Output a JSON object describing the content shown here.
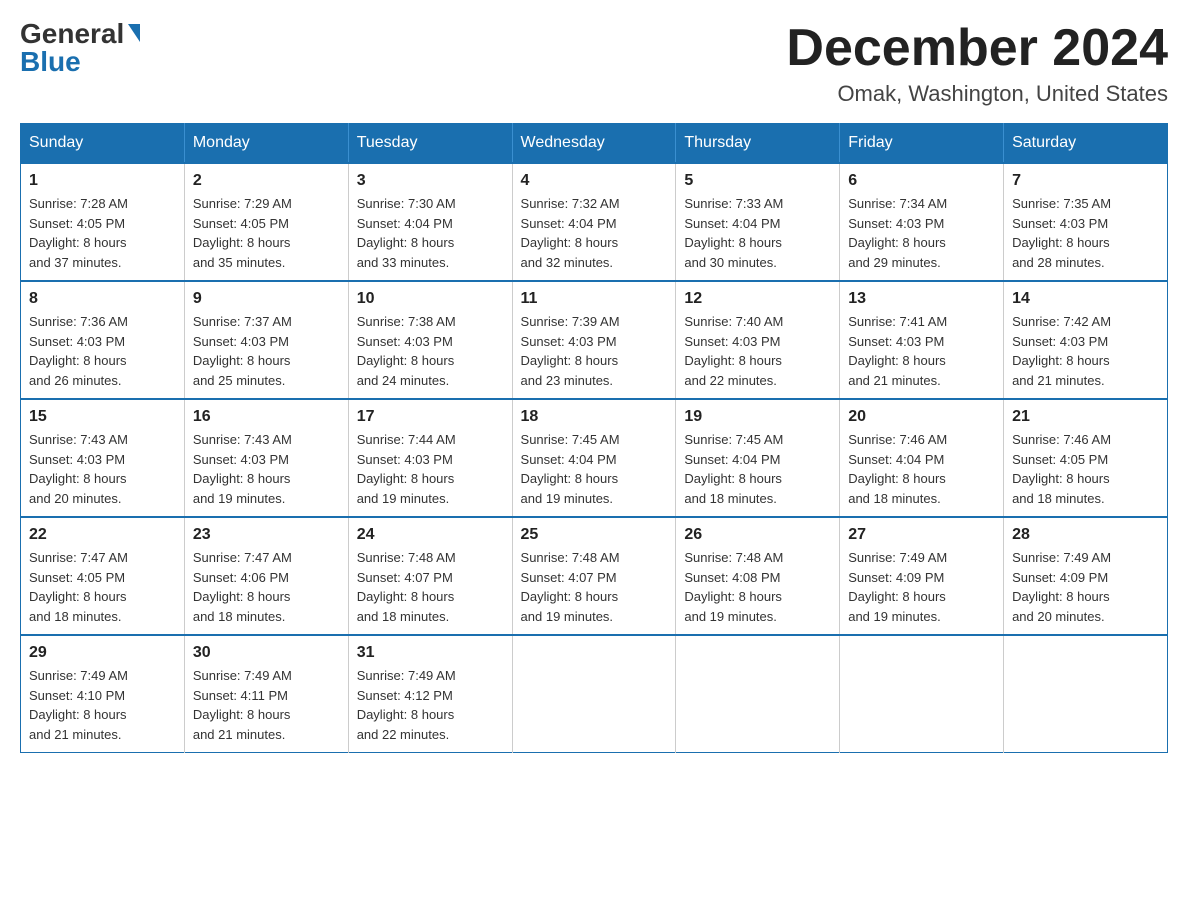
{
  "logo": {
    "general": "General",
    "blue": "Blue"
  },
  "title": "December 2024",
  "subtitle": "Omak, Washington, United States",
  "days_of_week": [
    "Sunday",
    "Monday",
    "Tuesday",
    "Wednesday",
    "Thursday",
    "Friday",
    "Saturday"
  ],
  "weeks": [
    [
      {
        "day": "1",
        "sunrise": "Sunrise: 7:28 AM",
        "sunset": "Sunset: 4:05 PM",
        "daylight": "Daylight: 8 hours",
        "daylight2": "and 37 minutes."
      },
      {
        "day": "2",
        "sunrise": "Sunrise: 7:29 AM",
        "sunset": "Sunset: 4:05 PM",
        "daylight": "Daylight: 8 hours",
        "daylight2": "and 35 minutes."
      },
      {
        "day": "3",
        "sunrise": "Sunrise: 7:30 AM",
        "sunset": "Sunset: 4:04 PM",
        "daylight": "Daylight: 8 hours",
        "daylight2": "and 33 minutes."
      },
      {
        "day": "4",
        "sunrise": "Sunrise: 7:32 AM",
        "sunset": "Sunset: 4:04 PM",
        "daylight": "Daylight: 8 hours",
        "daylight2": "and 32 minutes."
      },
      {
        "day": "5",
        "sunrise": "Sunrise: 7:33 AM",
        "sunset": "Sunset: 4:04 PM",
        "daylight": "Daylight: 8 hours",
        "daylight2": "and 30 minutes."
      },
      {
        "day": "6",
        "sunrise": "Sunrise: 7:34 AM",
        "sunset": "Sunset: 4:03 PM",
        "daylight": "Daylight: 8 hours",
        "daylight2": "and 29 minutes."
      },
      {
        "day": "7",
        "sunrise": "Sunrise: 7:35 AM",
        "sunset": "Sunset: 4:03 PM",
        "daylight": "Daylight: 8 hours",
        "daylight2": "and 28 minutes."
      }
    ],
    [
      {
        "day": "8",
        "sunrise": "Sunrise: 7:36 AM",
        "sunset": "Sunset: 4:03 PM",
        "daylight": "Daylight: 8 hours",
        "daylight2": "and 26 minutes."
      },
      {
        "day": "9",
        "sunrise": "Sunrise: 7:37 AM",
        "sunset": "Sunset: 4:03 PM",
        "daylight": "Daylight: 8 hours",
        "daylight2": "and 25 minutes."
      },
      {
        "day": "10",
        "sunrise": "Sunrise: 7:38 AM",
        "sunset": "Sunset: 4:03 PM",
        "daylight": "Daylight: 8 hours",
        "daylight2": "and 24 minutes."
      },
      {
        "day": "11",
        "sunrise": "Sunrise: 7:39 AM",
        "sunset": "Sunset: 4:03 PM",
        "daylight": "Daylight: 8 hours",
        "daylight2": "and 23 minutes."
      },
      {
        "day": "12",
        "sunrise": "Sunrise: 7:40 AM",
        "sunset": "Sunset: 4:03 PM",
        "daylight": "Daylight: 8 hours",
        "daylight2": "and 22 minutes."
      },
      {
        "day": "13",
        "sunrise": "Sunrise: 7:41 AM",
        "sunset": "Sunset: 4:03 PM",
        "daylight": "Daylight: 8 hours",
        "daylight2": "and 21 minutes."
      },
      {
        "day": "14",
        "sunrise": "Sunrise: 7:42 AM",
        "sunset": "Sunset: 4:03 PM",
        "daylight": "Daylight: 8 hours",
        "daylight2": "and 21 minutes."
      }
    ],
    [
      {
        "day": "15",
        "sunrise": "Sunrise: 7:43 AM",
        "sunset": "Sunset: 4:03 PM",
        "daylight": "Daylight: 8 hours",
        "daylight2": "and 20 minutes."
      },
      {
        "day": "16",
        "sunrise": "Sunrise: 7:43 AM",
        "sunset": "Sunset: 4:03 PM",
        "daylight": "Daylight: 8 hours",
        "daylight2": "and 19 minutes."
      },
      {
        "day": "17",
        "sunrise": "Sunrise: 7:44 AM",
        "sunset": "Sunset: 4:03 PM",
        "daylight": "Daylight: 8 hours",
        "daylight2": "and 19 minutes."
      },
      {
        "day": "18",
        "sunrise": "Sunrise: 7:45 AM",
        "sunset": "Sunset: 4:04 PM",
        "daylight": "Daylight: 8 hours",
        "daylight2": "and 19 minutes."
      },
      {
        "day": "19",
        "sunrise": "Sunrise: 7:45 AM",
        "sunset": "Sunset: 4:04 PM",
        "daylight": "Daylight: 8 hours",
        "daylight2": "and 18 minutes."
      },
      {
        "day": "20",
        "sunrise": "Sunrise: 7:46 AM",
        "sunset": "Sunset: 4:04 PM",
        "daylight": "Daylight: 8 hours",
        "daylight2": "and 18 minutes."
      },
      {
        "day": "21",
        "sunrise": "Sunrise: 7:46 AM",
        "sunset": "Sunset: 4:05 PM",
        "daylight": "Daylight: 8 hours",
        "daylight2": "and 18 minutes."
      }
    ],
    [
      {
        "day": "22",
        "sunrise": "Sunrise: 7:47 AM",
        "sunset": "Sunset: 4:05 PM",
        "daylight": "Daylight: 8 hours",
        "daylight2": "and 18 minutes."
      },
      {
        "day": "23",
        "sunrise": "Sunrise: 7:47 AM",
        "sunset": "Sunset: 4:06 PM",
        "daylight": "Daylight: 8 hours",
        "daylight2": "and 18 minutes."
      },
      {
        "day": "24",
        "sunrise": "Sunrise: 7:48 AM",
        "sunset": "Sunset: 4:07 PM",
        "daylight": "Daylight: 8 hours",
        "daylight2": "and 18 minutes."
      },
      {
        "day": "25",
        "sunrise": "Sunrise: 7:48 AM",
        "sunset": "Sunset: 4:07 PM",
        "daylight": "Daylight: 8 hours",
        "daylight2": "and 19 minutes."
      },
      {
        "day": "26",
        "sunrise": "Sunrise: 7:48 AM",
        "sunset": "Sunset: 4:08 PM",
        "daylight": "Daylight: 8 hours",
        "daylight2": "and 19 minutes."
      },
      {
        "day": "27",
        "sunrise": "Sunrise: 7:49 AM",
        "sunset": "Sunset: 4:09 PM",
        "daylight": "Daylight: 8 hours",
        "daylight2": "and 19 minutes."
      },
      {
        "day": "28",
        "sunrise": "Sunrise: 7:49 AM",
        "sunset": "Sunset: 4:09 PM",
        "daylight": "Daylight: 8 hours",
        "daylight2": "and 20 minutes."
      }
    ],
    [
      {
        "day": "29",
        "sunrise": "Sunrise: 7:49 AM",
        "sunset": "Sunset: 4:10 PM",
        "daylight": "Daylight: 8 hours",
        "daylight2": "and 21 minutes."
      },
      {
        "day": "30",
        "sunrise": "Sunrise: 7:49 AM",
        "sunset": "Sunset: 4:11 PM",
        "daylight": "Daylight: 8 hours",
        "daylight2": "and 21 minutes."
      },
      {
        "day": "31",
        "sunrise": "Sunrise: 7:49 AM",
        "sunset": "Sunset: 4:12 PM",
        "daylight": "Daylight: 8 hours",
        "daylight2": "and 22 minutes."
      },
      null,
      null,
      null,
      null
    ]
  ]
}
